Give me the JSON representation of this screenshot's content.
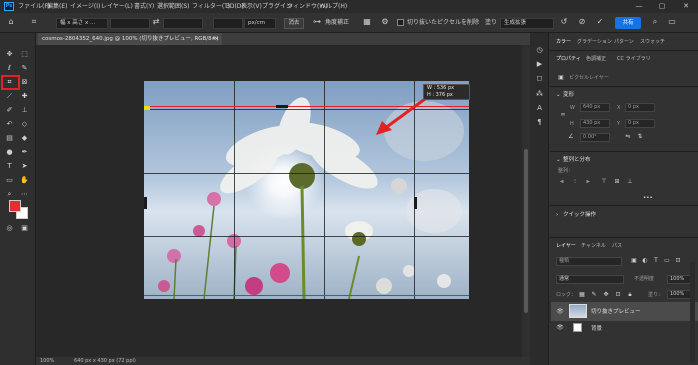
{
  "menubar": {
    "logo": "Ps",
    "items": [
      "ファイル(F)",
      "編集(E)",
      "イメージ(I)",
      "レイヤー(L)",
      "書式(Y)",
      "選択範囲(S)",
      "フィルター(T)",
      "3D(D)",
      "表示(V)",
      "プラグイン",
      "ウィンドウ(W)",
      "ヘルプ(H)"
    ],
    "window_controls": [
      "—",
      "▢",
      "✕"
    ]
  },
  "options_bar": {
    "ratio_value": "幅 x 高さ x ...",
    "unit_value": "px/cm",
    "clear_label": "消去",
    "straighten_label": "角度補正",
    "delete_crop_label": "切り抜いたピクセルを削除",
    "fill_label": "塗り",
    "fill_value": "生成拡張",
    "share_label": "共有"
  },
  "document": {
    "tab_title": "cosmos-2804352_640.jpg @ 100% (切り抜きプレビュー, RGB/8#)",
    "close_glyph": "×"
  },
  "crop": {
    "tooltip_w": "W : 536 px",
    "tooltip_h": "H : 376 px"
  },
  "statusbar": {
    "zoom": "100%",
    "doc_size": "640 px x 430 px (72 ppi)"
  },
  "panels": {
    "top_tabs": [
      "カラー",
      "グラデーション",
      "パターン",
      "スウォッチ"
    ],
    "second_tabs": [
      "プロパティ",
      "色調補正",
      "CC ライブラリ"
    ],
    "pixel_layer_label": "ピクセルレイヤー",
    "transform_title": "変形",
    "w_label": "W",
    "h_label": "H",
    "x_label": "X",
    "y_label": "Y",
    "w_value": "640 px",
    "h_value": "430 px",
    "x_value": "0 px",
    "y_value": "0 px",
    "angle_value": "0.00°",
    "align_title": "整列と分布",
    "align_sub": "整列：",
    "more": "•••",
    "quick_actions_title": "クイック操作"
  },
  "layers": {
    "tabs": [
      "レイヤー",
      "チャンネル",
      "パス"
    ],
    "kind_label": "種類",
    "mode_value": "通常",
    "opacity_label": "不透明度",
    "opacity_value": "100%",
    "lock_label": "ロック：",
    "fill_label": "塗り：",
    "fill_value": "100%",
    "rows": [
      {
        "name": "切り抜きプレビュー"
      },
      {
        "name": "背景"
      }
    ]
  },
  "colors": {
    "accent": "#e22323",
    "share": "#1473e6",
    "foreground": "#e52f2f",
    "background": "#ffffff"
  }
}
